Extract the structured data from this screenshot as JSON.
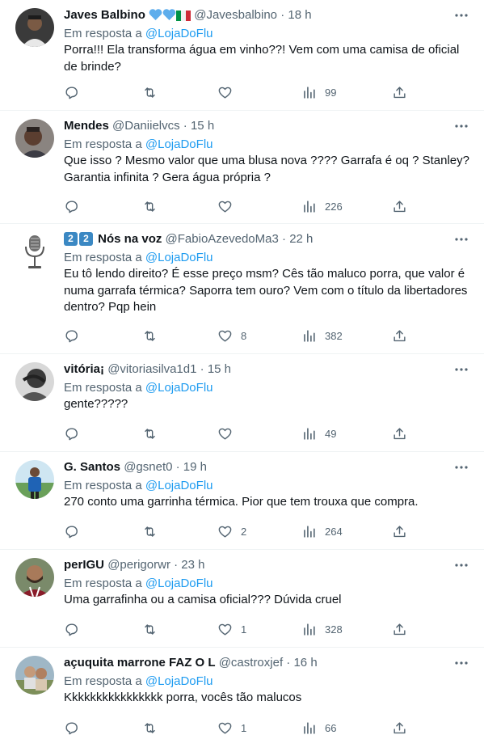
{
  "ui": {
    "reply_prefix": "Em resposta a",
    "dot": "·"
  },
  "colors": {
    "text": "#0f1419",
    "muted": "#536471",
    "link": "#1d9bf0",
    "divider": "#eff3f4"
  },
  "tweets": [
    {
      "name": "Javes Balbino",
      "name_emoji": [
        "blue-heart",
        "blue-heart",
        "italy-flag"
      ],
      "handle": "@Javesbalbino",
      "time": "18 h",
      "reply_to": "@LojaDoFlu",
      "text": "Porra!!! Ela transforma água em vinho??! Vem com uma camisa de oficial de brinde?",
      "likes": "",
      "views": "99",
      "avatar": "person-dark-bg"
    },
    {
      "name": "Mendes",
      "handle": "@Daniielvcs",
      "time": "15 h",
      "reply_to": "@LojaDoFlu",
      "text": "Que isso ? Mesmo valor que uma blusa nova ???? Garrafa é oq ? Stanley? Garantia infinita ? Gera água própria ?",
      "likes": "",
      "views": "226",
      "avatar": "person-selfie"
    },
    {
      "name": "Nós na voz",
      "name_prefix": [
        "2",
        "2"
      ],
      "handle": "@FabioAzevedoMa3",
      "time": "22 h",
      "reply_to": "@LojaDoFlu",
      "text": "Eu tô lendo direito? É esse preço msm? Cês tão maluco porra, que valor é numa garrafa térmica? Saporra tem ouro? Vem com o título da libertadores dentro? Pqp hein",
      "likes": "8",
      "views": "382",
      "avatar": "microphone"
    },
    {
      "name": "vitória¡",
      "handle": "@vitoriasilva1d1",
      "time": "15 h",
      "reply_to": "@LojaDoFlu",
      "text": "gente?????",
      "likes": "",
      "views": "49",
      "avatar": "person-bw"
    },
    {
      "name": "G. Santos",
      "handle": "@gsnet0",
      "time": "19 h",
      "reply_to": "@LojaDoFlu",
      "text": "270 conto uma garrinha térmica. Pior que tem trouxa que compra.",
      "likes": "2",
      "views": "264",
      "avatar": "person-stadium"
    },
    {
      "name": "perIGU",
      "handle": "@perigorwr",
      "time": "23 h",
      "reply_to": "@LojaDoFlu",
      "text": "Uma garrafinha ou a camisa oficial??? Dúvida cruel",
      "likes": "1",
      "views": "328",
      "avatar": "person-beard"
    },
    {
      "name": "açuquita marrone FAZ O L",
      "handle": "@castroxjef",
      "time": "16 h",
      "reply_to": "@LojaDoFlu",
      "text": "Kkkkkkkkkkkkkkkk porra, vocês tão malucos",
      "likes": "1",
      "views": "66",
      "avatar": "person-outdoor"
    }
  ]
}
